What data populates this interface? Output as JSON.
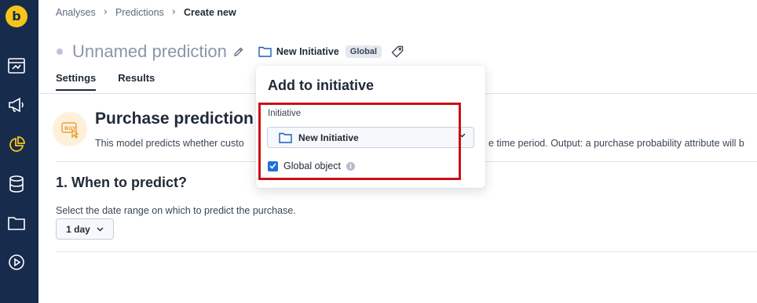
{
  "sidebar": {
    "logo_letter": "b",
    "nav_icons": [
      "dashboard-icon",
      "megaphone-icon",
      "pie-chart-icon",
      "database-icon",
      "folder-icon",
      "play-circle-icon"
    ],
    "colors": {
      "background": "#172b4d",
      "active": "#f5c518",
      "icon": "#ffffff"
    }
  },
  "breadcrumb": {
    "items": [
      "Analyses",
      "Predictions",
      "Create new"
    ],
    "separator": "›"
  },
  "header": {
    "title": "Unnamed prediction",
    "initiative": "New Initiative",
    "badge": "Global"
  },
  "tabs": [
    {
      "label": "Settings",
      "active": true
    },
    {
      "label": "Results",
      "active": false
    }
  ],
  "main": {
    "heading": "Purchase prediction",
    "description_left": "This model predicts whether custo",
    "description_right": "e time period. Output: a purchase probability attribute will b",
    "section_title": "1. When to predict?",
    "date_label": "Select the date range on which to predict the purchase.",
    "date_value": "1 day"
  },
  "popover": {
    "title": "Add to initiative",
    "field_label": "Initiative",
    "selected_initiative": "New Initiative",
    "checkbox_label": "Global object",
    "checkbox_checked": true,
    "info_glyph": "i",
    "highlight_color": "#cc1016"
  }
}
